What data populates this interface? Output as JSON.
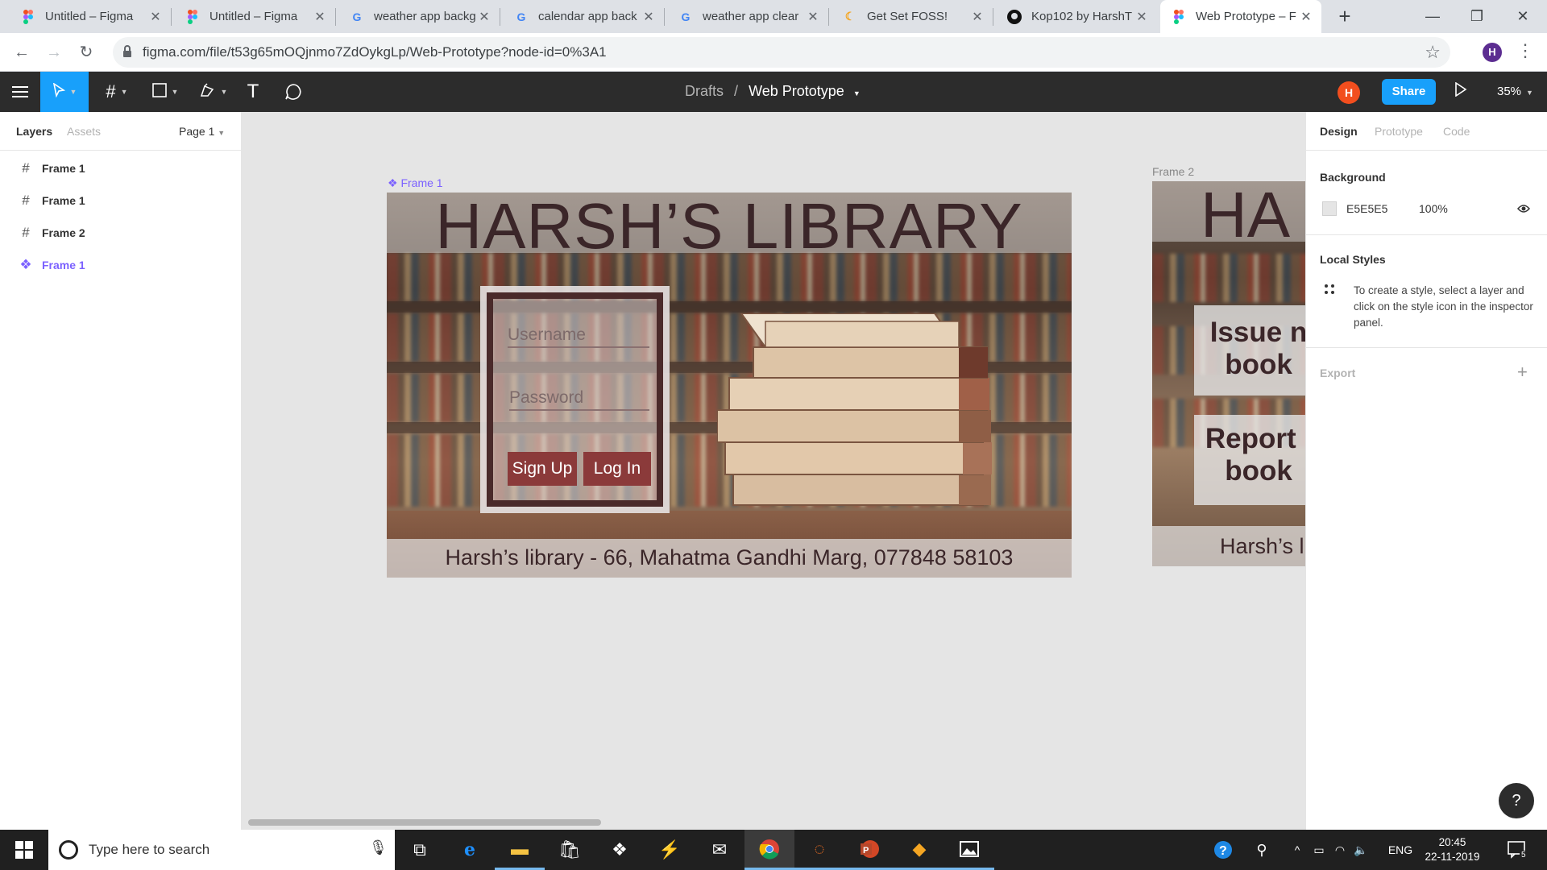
{
  "browser": {
    "tabs": [
      {
        "title": "Untitled – Figma",
        "icon": "figma-icon"
      },
      {
        "title": "Untitled – Figma",
        "icon": "figma-icon"
      },
      {
        "title": "weather app backg",
        "icon": "google-icon"
      },
      {
        "title": "calendar app back",
        "icon": "google-icon"
      },
      {
        "title": "weather app clear",
        "icon": "google-icon"
      },
      {
        "title": "Get Set FOSS!",
        "icon": "getsetfoss-icon"
      },
      {
        "title": "Kop102 by HarshT",
        "icon": "github-icon"
      },
      {
        "title": "Web Prototype – F",
        "icon": "figma-icon"
      }
    ],
    "url": "figma.com/file/t53g65mOQjnmo7ZdOykgLp/Web-Prototype?node-id=0%3A1",
    "profile_initial": "H"
  },
  "figma": {
    "breadcrumb_root": "Drafts",
    "breadcrumb_sep": "/",
    "file_name": "Web Prototype",
    "user_initial": "H",
    "share_label": "Share",
    "zoom": "35%"
  },
  "left_panel": {
    "tab_layers": "Layers",
    "tab_assets": "Assets",
    "page": "Page 1",
    "layers": [
      {
        "name": "Frame 1",
        "type": "frame"
      },
      {
        "name": "Frame 1",
        "type": "frame"
      },
      {
        "name": "Frame 2",
        "type": "frame"
      },
      {
        "name": "Frame 1",
        "type": "component"
      }
    ]
  },
  "canvas": {
    "frame1_label": "Frame 1",
    "frame2_label": "Frame 2",
    "frame1": {
      "title": "HARSH’S LIBRARY",
      "username_placeholder": "Username",
      "password_placeholder": "Password",
      "signup_label": "Sign Up",
      "login_label": "Log In",
      "footer": "Harsh’s library - 66, Mahatma Gandhi Marg, 077848 58103"
    },
    "frame2": {
      "title": "HA",
      "card1_line1": "Issue n",
      "card1_line2": "book",
      "card2_line1": "Report l",
      "card2_line2": "book",
      "footer": "Harsh’s li"
    }
  },
  "right_panel": {
    "tab_design": "Design",
    "tab_prototype": "Prototype",
    "tab_code": "Code",
    "background_heading": "Background",
    "bg_hex": "E5E5E5",
    "bg_opacity": "100%",
    "local_styles_heading": "Local Styles",
    "local_styles_text": "To create a style, select a layer and click on the style icon in the inspector panel.",
    "export_heading": "Export",
    "export_plus": "+",
    "help_label": "?"
  },
  "taskbar": {
    "search_placeholder": "Type here to search",
    "language": "ENG",
    "time": "20:45",
    "date": "22-11-2019",
    "notification_count": "5"
  },
  "colors": {
    "figma_blue": "#18a0fb",
    "figma_toolbar": "#2c2c2c",
    "component_purple": "#7b61ff",
    "library_button": "#8b3a3a",
    "title_text": "#3b2629"
  }
}
